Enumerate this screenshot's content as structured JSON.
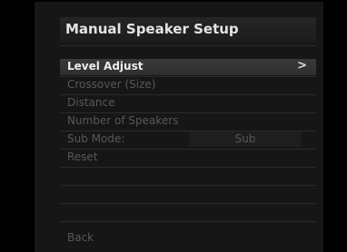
{
  "title": "Manual Speaker Setup",
  "menu": {
    "items": [
      {
        "label": "Level Adjust"
      },
      {
        "label": "Crossover (Size)"
      },
      {
        "label": "Distance"
      },
      {
        "label": "Number of Speakers"
      },
      {
        "label": "Sub Mode:",
        "value": "Sub"
      },
      {
        "label": "Reset"
      }
    ],
    "chevron": ">"
  },
  "back_label": "Back",
  "icons": {
    "chevron": "chevron-right-icon"
  },
  "colors": {
    "highlight": "#343434",
    "text_active": "#ececec",
    "text_dim": "#585858"
  }
}
